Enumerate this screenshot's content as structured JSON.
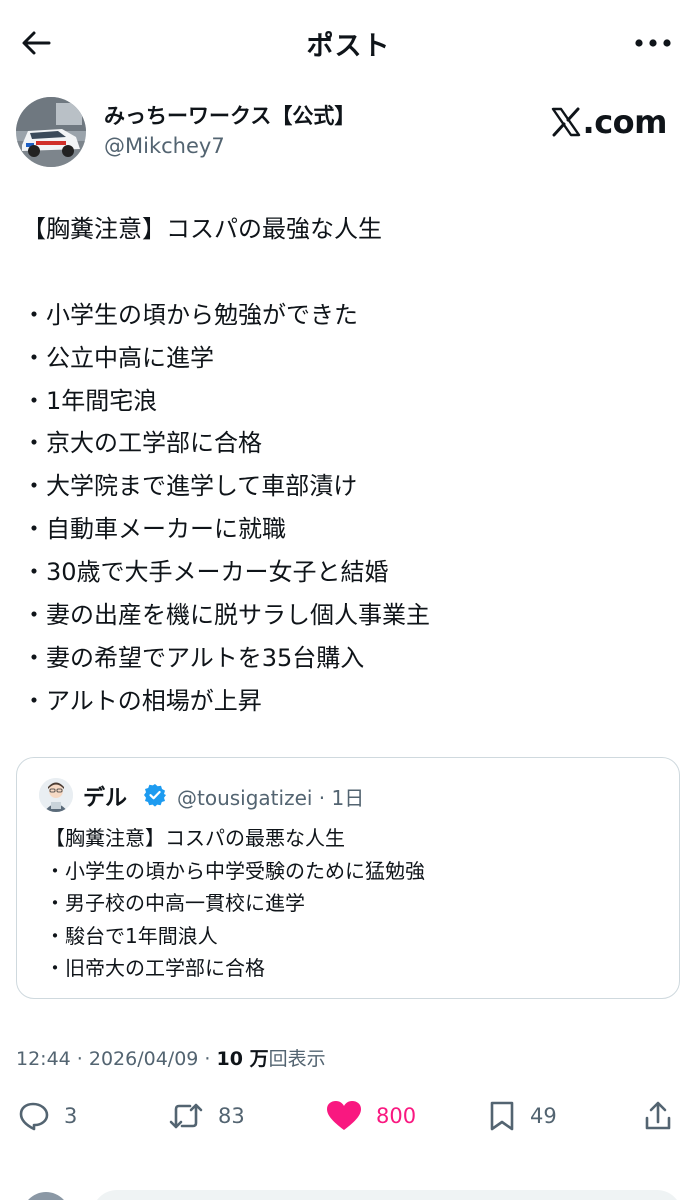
{
  "header": {
    "title": "ポスト"
  },
  "author": {
    "name": "みっちーワークス【公式】",
    "handle": "@Mikchey7"
  },
  "watermark": {
    "x_glyph": "𝕏",
    "text": ".com"
  },
  "post": {
    "lines": [
      "【胸糞注意】コスパの最強な人生",
      "",
      "・小学生の頃から勉強ができた",
      "・公立中高に進学",
      "・1年間宅浪",
      "・京大の工学部に合格",
      "・大学院まで進学して車部漬け",
      "・自動車メーカーに就職",
      "・30歳で大手メーカー女子と結婚",
      "・妻の出産を機に脱サラし個人事業主",
      "・妻の希望でアルトを35台購入",
      "・アルトの相場が上昇"
    ]
  },
  "quote": {
    "name": "デル",
    "handle_time": "@tousigatizei · 1日",
    "lines": [
      "【胸糞注意】コスパの最悪な人生",
      "・小学生の頃から中学受験のために猛勉強",
      "・男子校の中高一貫校に進学",
      "・駿台で1年間浪人",
      "・旧帝大の工学部に合格"
    ]
  },
  "meta": {
    "datetime": "12:44 · 2026/04/09 · ",
    "views_value": "10 万",
    "views_label": "回表示"
  },
  "actions": {
    "replies": "3",
    "reposts": "83",
    "likes": "800",
    "bookmarks": "49"
  },
  "colors": {
    "text": "#0f1419",
    "secondary": "#536471",
    "like": "#f91880",
    "verified": "#1d9bf0",
    "border": "#cfd9de"
  }
}
